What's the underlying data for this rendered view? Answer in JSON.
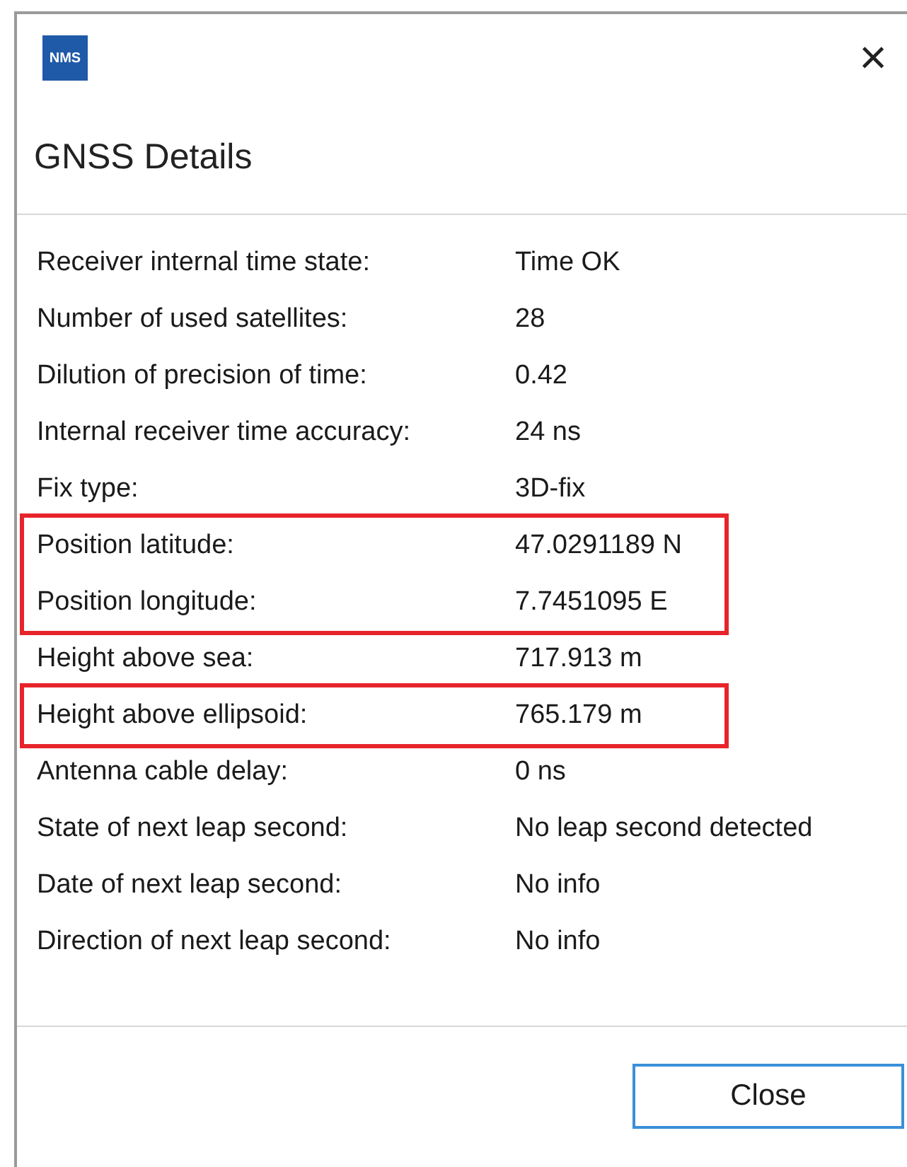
{
  "window": {
    "logo": "NMS",
    "close_glyph": "×"
  },
  "header": {
    "title": "GNSS Details"
  },
  "rows": [
    {
      "label": "Receiver internal time state:",
      "value": "Time OK",
      "highlighted": false
    },
    {
      "label": "Number of used satellites:",
      "value": "28",
      "highlighted": false
    },
    {
      "label": "Dilution of precision of time:",
      "value": "0.42",
      "highlighted": false
    },
    {
      "label": "Internal receiver time accuracy:",
      "value": "24 ns",
      "highlighted": false
    },
    {
      "label": "Fix type:",
      "value": "3D-fix",
      "highlighted": false
    },
    {
      "label": "Position latitude:",
      "value": "47.0291189 N",
      "highlighted": true
    },
    {
      "label": "Position longitude:",
      "value": "7.7451095 E",
      "highlighted": true
    },
    {
      "label": "Height above sea:",
      "value": "717.913 m",
      "highlighted": false
    },
    {
      "label": "Height above ellipsoid:",
      "value": "765.179 m",
      "highlighted": true
    },
    {
      "label": "Antenna cable delay:",
      "value": "0 ns",
      "highlighted": false
    },
    {
      "label": "State of next leap second:",
      "value": "No leap second detected",
      "highlighted": false
    },
    {
      "label": "Date of next leap second:",
      "value": "No info",
      "highlighted": false
    },
    {
      "label": "Direction of next leap second:",
      "value": "No info",
      "highlighted": false
    }
  ],
  "buttons": [
    {
      "label": "Close"
    }
  ]
}
